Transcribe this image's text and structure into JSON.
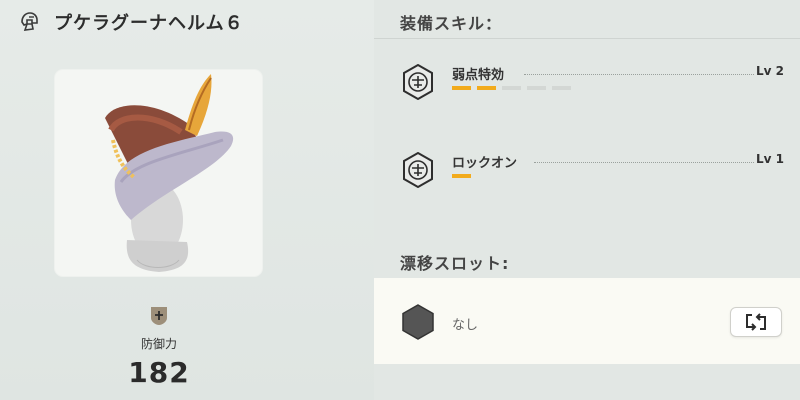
{
  "armor": {
    "name": "プケラグーナヘルム６",
    "icon": "helm-icon"
  },
  "defense": {
    "label": "防御力",
    "value": "182"
  },
  "skills_section": {
    "title": "装備スキル：",
    "skills": [
      {
        "name": "弱点特効",
        "level": "Lv 2",
        "filled": 2,
        "max": 5,
        "icon": "skill-crest-icon"
      },
      {
        "name": "ロックオン",
        "level": "Lv 1",
        "filled": 1,
        "max": 1,
        "icon": "skill-crest-icon"
      }
    ]
  },
  "decoration_section": {
    "title": "漂移スロット:",
    "slot_text": "なし",
    "swap_icon": "swap-icon"
  },
  "colors": {
    "accent": "#f2ab1c",
    "empty_bar": "#d3d7d4",
    "slot_hex": "#555555"
  }
}
